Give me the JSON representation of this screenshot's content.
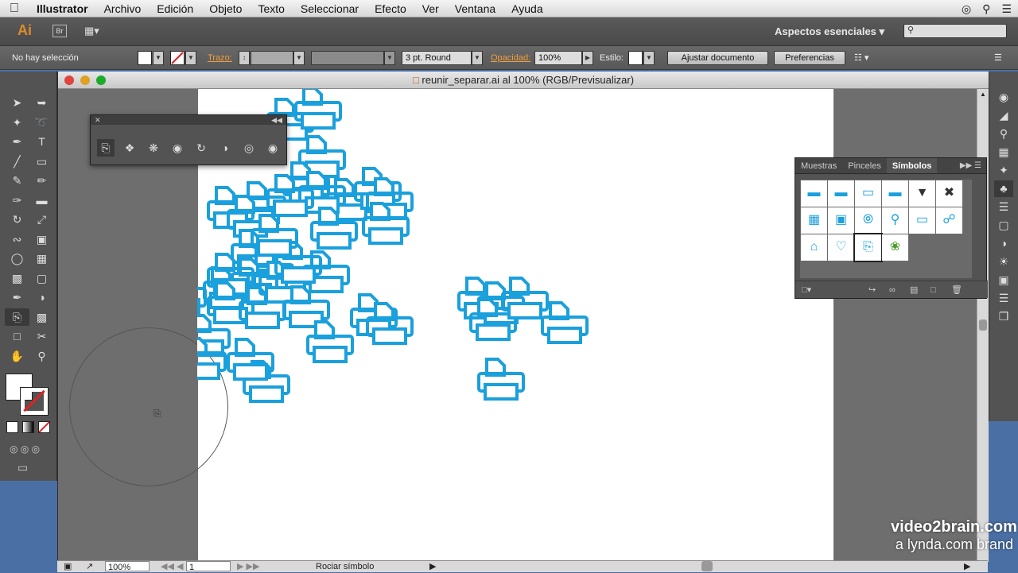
{
  "menubar": {
    "apple": "",
    "items": [
      "Illustrator",
      "Archivo",
      "Edición",
      "Objeto",
      "Texto",
      "Seleccionar",
      "Efecto",
      "Ver",
      "Ventana",
      "Ayuda"
    ]
  },
  "appbar": {
    "logo": "Ai",
    "bridge": "Br",
    "workspace": "Aspectos esenciales",
    "search_placeholder": ""
  },
  "control": {
    "selection": "No hay selección",
    "trazo_label": "Trazo:",
    "stroke_profile": "3 pt. Round",
    "opacity_label": "Opacidad:",
    "opacity_value": "100%",
    "style_label": "Estilo:",
    "doc_button": "Ajustar documento",
    "prefs_button": "Preferencias"
  },
  "document": {
    "title": "reunir_separar.ai al 100% (RGB/Previsualizar)",
    "icon_color": "#1aa0dc"
  },
  "symbols_panel": {
    "tabs": [
      "Muestras",
      "Pinceles",
      "Símbolos"
    ],
    "active_tab": "Símbolos"
  },
  "status": {
    "zoom": "100%",
    "page": "1",
    "tool": "Rociar símbolo"
  },
  "watermark": {
    "line1": "video2brain.com",
    "line2": "a lynda.com brand"
  }
}
